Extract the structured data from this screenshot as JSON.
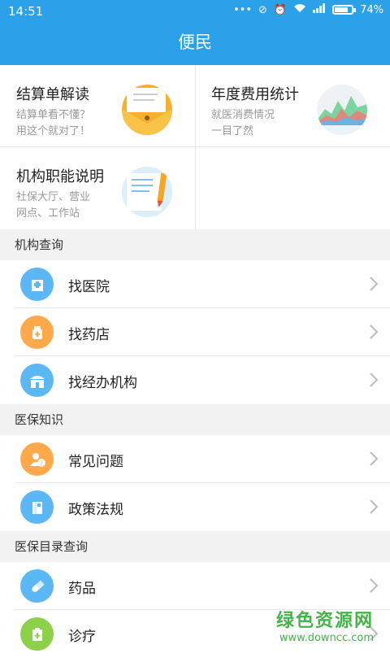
{
  "status_bar": {
    "time": "14:51",
    "battery": "74%"
  },
  "app_bar": {
    "title": "便民"
  },
  "cards": [
    {
      "title": "结算单解读",
      "subtitle": "结算单看不懂？\n用这个就对了！",
      "icon": "envelope-icon"
    },
    {
      "title": "年度费用统计",
      "subtitle": "就医消费情况\n一目了然",
      "icon": "area-chart-icon"
    },
    {
      "title": "机构职能说明",
      "subtitle": "社保大厅、营业\n网点、工作站",
      "icon": "document-pencil-icon"
    }
  ],
  "sections": [
    {
      "title": "机构查询",
      "items": [
        {
          "label": "找医院",
          "icon": "hospital-icon",
          "color": "#5bb8f5"
        },
        {
          "label": "找药店",
          "icon": "pharmacy-icon",
          "color": "#ffa94a"
        },
        {
          "label": "找经办机构",
          "icon": "office-icon",
          "color": "#5bb8f5"
        }
      ]
    },
    {
      "title": "医保知识",
      "items": [
        {
          "label": "常见问题",
          "icon": "question-icon",
          "color": "#ffa94a"
        },
        {
          "label": "政策法规",
          "icon": "book-icon",
          "color": "#5bb8f5"
        }
      ]
    },
    {
      "title": "医保目录查询",
      "items": [
        {
          "label": "药品",
          "icon": "pill-icon",
          "color": "#5bb8f5"
        },
        {
          "label": "诊疗",
          "icon": "treatment-icon",
          "color": "#8dd04a"
        }
      ]
    }
  ],
  "watermark": {
    "text": "绿色资源网",
    "url": "www.downcc.com"
  }
}
